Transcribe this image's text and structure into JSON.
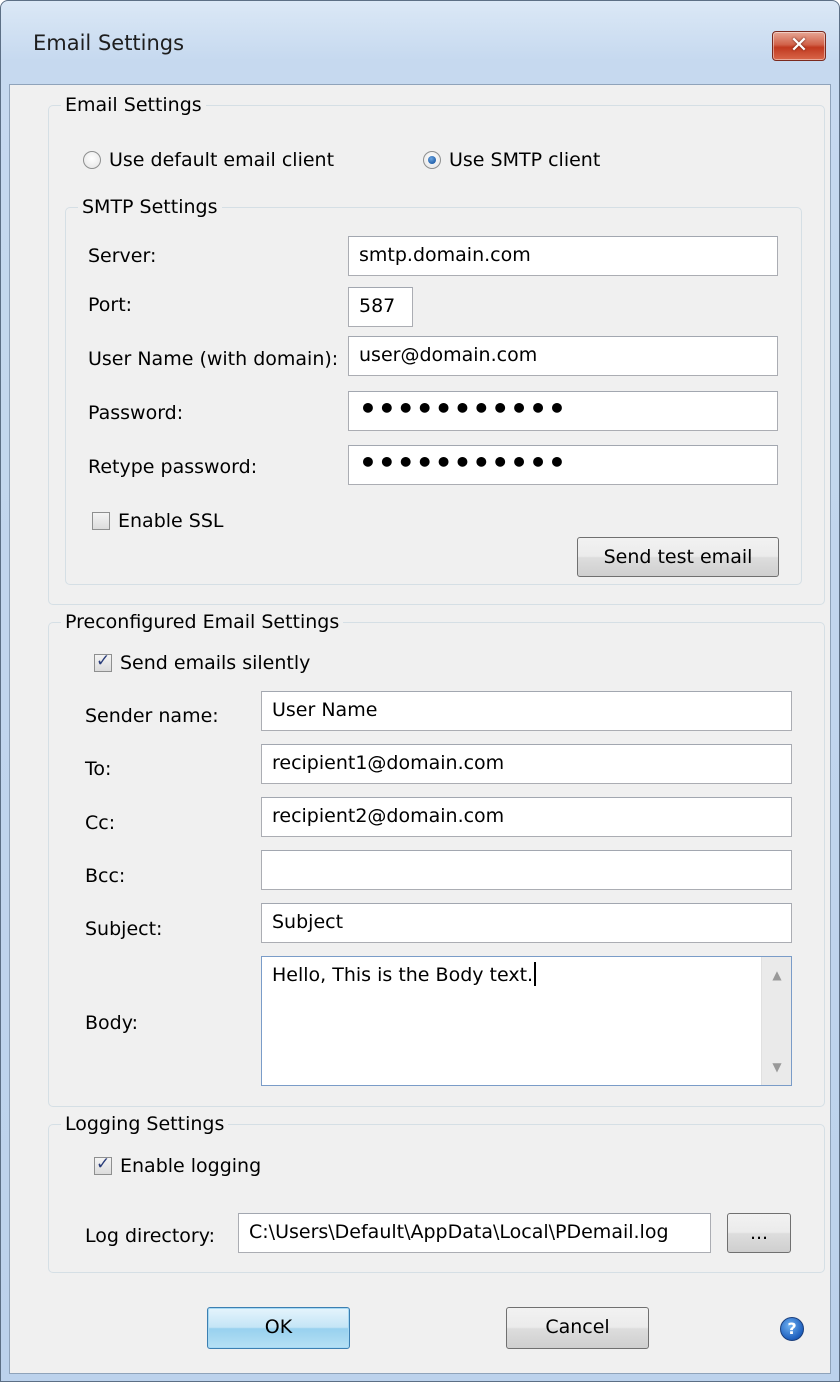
{
  "window": {
    "title": "Email Settings",
    "close_glyph": "✕"
  },
  "email_settings": {
    "legend": "Email Settings",
    "radio_default_label": "Use default email client",
    "radio_smtp_label": "Use SMTP client",
    "selected": "smtp"
  },
  "smtp": {
    "legend": "SMTP Settings",
    "server_label": "Server:",
    "server_value": "smtp.domain.com",
    "port_label": "Port:",
    "port_value": "587",
    "username_label": "User Name (with domain):",
    "username_value": "user@domain.com",
    "password_label": "Password:",
    "password_value": "•••••••••••",
    "retype_label": "Retype password:",
    "retype_value": "•••••••••••",
    "ssl_label": "Enable SSL",
    "ssl_checked": false,
    "test_button": "Send test email"
  },
  "preconfigured": {
    "legend": "Preconfigured Email Settings",
    "silent_label": "Send emails silently",
    "silent_checked": true,
    "sender_label": "Sender name:",
    "sender_value": "User Name",
    "to_label": "To:",
    "to_value": "recipient1@domain.com",
    "cc_label": "Cc:",
    "cc_value": "recipient2@domain.com",
    "bcc_label": "Bcc:",
    "bcc_value": "",
    "subject_label": "Subject:",
    "subject_value": "Subject",
    "body_label": "Body:",
    "body_value": "Hello, This is the Body text."
  },
  "logging": {
    "legend": "Logging Settings",
    "enable_label": "Enable logging",
    "enable_checked": true,
    "dir_label": "Log directory:",
    "dir_value": "C:\\Users\\Default\\AppData\\Local\\PDemail.log",
    "browse_label": "..."
  },
  "footer": {
    "ok_label": "OK",
    "cancel_label": "Cancel",
    "help_glyph": "?"
  },
  "icons": {
    "close": "close-icon",
    "help": "help-icon",
    "scroll_up": "chevron-up-icon",
    "scroll_down": "chevron-down-icon",
    "checkmark": "checkmark-icon"
  }
}
